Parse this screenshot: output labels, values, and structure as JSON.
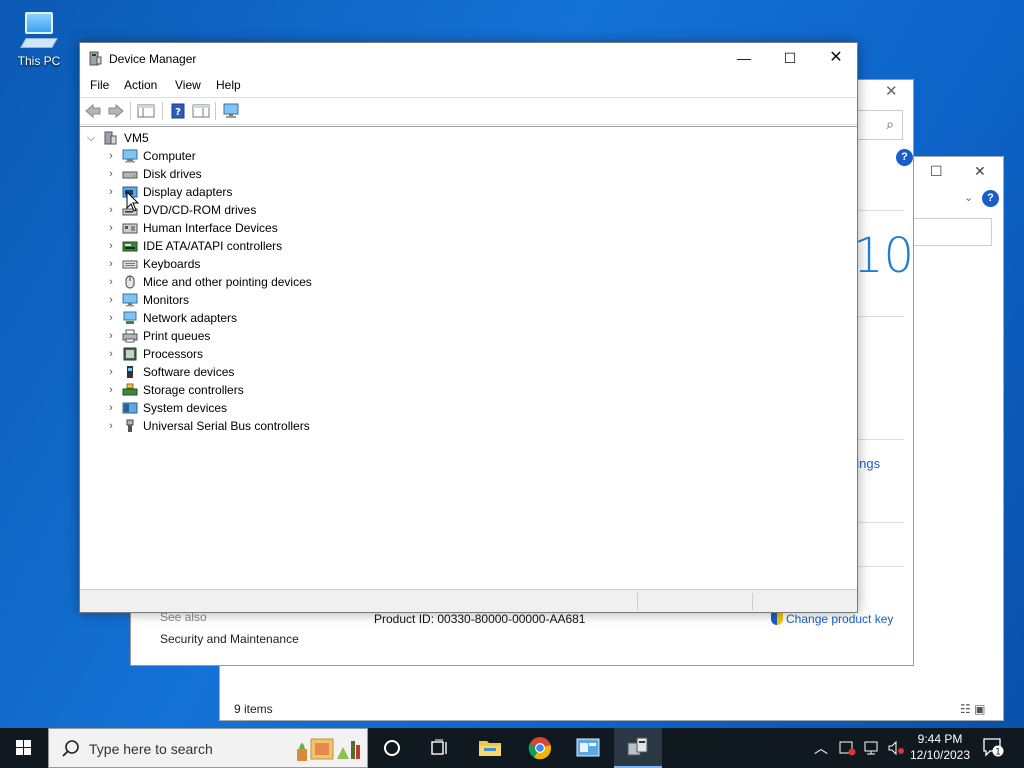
{
  "desktop": {
    "this_pc_label": "This PC"
  },
  "background_window_2": {
    "status": "9 items",
    "minimize": "—",
    "maximize": "☐",
    "close": "✕"
  },
  "background_window_1": {
    "close": "✕",
    "win_version_fragment": "10",
    "settings_link_fragment": "ttings",
    "see_also": "See also",
    "security_link": "Security and Maintenance",
    "product_id": "Product ID:  00330-80000-00000-AA681",
    "change_product_key": "Change product key"
  },
  "device_manager": {
    "title": "Device Manager",
    "menu": [
      "File",
      "Action",
      "View",
      "Help"
    ],
    "root": "VM5",
    "categories": [
      {
        "label": "Computer",
        "icon": "computer-icon"
      },
      {
        "label": "Disk drives",
        "icon": "disk-drive-icon"
      },
      {
        "label": "Display adapters",
        "icon": "display-adapter-icon"
      },
      {
        "label": "DVD/CD-ROM drives",
        "icon": "dvd-drive-icon"
      },
      {
        "label": "Human Interface Devices",
        "icon": "hid-icon"
      },
      {
        "label": "IDE ATA/ATAPI controllers",
        "icon": "ide-controller-icon"
      },
      {
        "label": "Keyboards",
        "icon": "keyboard-icon"
      },
      {
        "label": "Mice and other pointing devices",
        "icon": "mouse-icon"
      },
      {
        "label": "Monitors",
        "icon": "monitor-icon"
      },
      {
        "label": "Network adapters",
        "icon": "network-adapter-icon"
      },
      {
        "label": "Print queues",
        "icon": "printer-icon"
      },
      {
        "label": "Processors",
        "icon": "processor-icon"
      },
      {
        "label": "Software devices",
        "icon": "software-device-icon"
      },
      {
        "label": "Storage controllers",
        "icon": "storage-controller-icon"
      },
      {
        "label": "System devices",
        "icon": "system-device-icon"
      },
      {
        "label": "Universal Serial Bus controllers",
        "icon": "usb-icon"
      }
    ]
  },
  "taskbar": {
    "search_placeholder": "Type here to search",
    "time": "9:44 PM",
    "date": "12/10/2023",
    "notification_count": "1"
  },
  "colors": {
    "accent": "#1a5fc8",
    "taskbar": "#101820",
    "desktop": "#0b5ab4"
  }
}
